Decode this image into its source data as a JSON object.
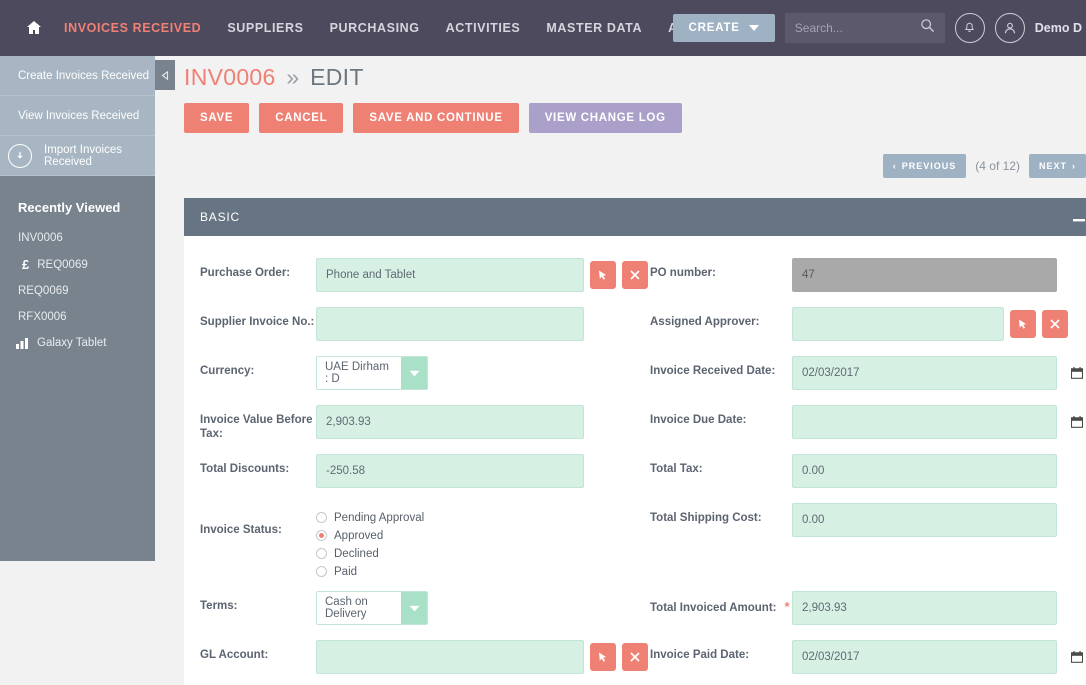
{
  "topnav": {
    "home_icon": "home-icon",
    "links": [
      {
        "label": "INVOICES RECEIVED",
        "active": true
      },
      {
        "label": "SUPPLIERS",
        "active": false
      },
      {
        "label": "PURCHASING",
        "active": false
      },
      {
        "label": "ACTIVITIES",
        "active": false
      },
      {
        "label": "MASTER DATA",
        "active": false
      },
      {
        "label": "ALL",
        "active": false
      }
    ],
    "create_label": "CREATE",
    "search_placeholder": "Search...",
    "search_value": "",
    "username": "Demo D",
    "accent": "#ef8074",
    "bar_color": "#4e4a5e"
  },
  "sidebar": {
    "actions": [
      {
        "label": "Create Invoices Received",
        "icon": ""
      },
      {
        "label": "View Invoices Received",
        "icon": ""
      },
      {
        "label": "Import Invoices Received",
        "icon": "download-circle-icon"
      }
    ],
    "recent_title": "Recently Viewed",
    "recent_items": [
      {
        "label": "INV0006",
        "icon": ""
      },
      {
        "label": "REQ0069",
        "icon": "£"
      },
      {
        "label": "REQ0069",
        "icon": ""
      },
      {
        "label": "RFX0006",
        "icon": ""
      },
      {
        "label": "Galaxy Tablet",
        "icon": "bar-chart-icon"
      }
    ]
  },
  "page": {
    "record_id": "INV0006",
    "separator": "»",
    "mode": "EDIT",
    "buttons": [
      {
        "label": "SAVE",
        "style": "coral"
      },
      {
        "label": "CANCEL",
        "style": "coral"
      },
      {
        "label": "SAVE AND CONTINUE",
        "style": "coral"
      },
      {
        "label": "VIEW CHANGE LOG",
        "style": "purple"
      }
    ],
    "pager": {
      "previous": "PREVIOUS",
      "count": "(4 of 12)",
      "next": "NEXT"
    }
  },
  "panel": {
    "title": "BASIC",
    "collapse_glyph": "—",
    "left_fields": [
      {
        "label": "Purchase Order:",
        "type": "text-picker",
        "value": "Phone and Tablet",
        "required": false
      },
      {
        "label": "Supplier Invoice No.:",
        "type": "text",
        "value": "",
        "required": false
      },
      {
        "label": "Currency:",
        "type": "select",
        "value": "UAE Dirham : D",
        "required": false
      },
      {
        "label": "Invoice Value Before Tax:",
        "type": "text",
        "value": "2,903.93",
        "required": false
      },
      {
        "label": "Total Discounts:",
        "type": "text",
        "value": "-250.58",
        "required": false
      },
      {
        "label": "Invoice Status:",
        "type": "radio",
        "value": "Approved",
        "required": false,
        "options": [
          "Pending Approval",
          "Approved",
          "Declined",
          "Paid"
        ]
      },
      {
        "label": "Terms:",
        "type": "select",
        "value": "Cash on Delivery",
        "required": false
      },
      {
        "label": "GL Account:",
        "type": "text-picker",
        "value": "",
        "required": false
      }
    ],
    "right_fields": [
      {
        "label": "PO number:",
        "type": "text",
        "value": "47",
        "disabled": true,
        "required": false
      },
      {
        "label": "Assigned Approver:",
        "type": "text-picker",
        "value": "",
        "required": false
      },
      {
        "label": "Invoice Received Date:",
        "type": "date",
        "value": "02/03/2017",
        "required": false
      },
      {
        "label": "Invoice Due Date:",
        "type": "date",
        "value": "",
        "required": false
      },
      {
        "label": "Total Tax:",
        "type": "text",
        "value": "0.00",
        "required": false
      },
      {
        "label": "Total Shipping Cost:",
        "type": "text",
        "value": "0.00",
        "required": false
      },
      {
        "label": "Total Invoiced Amount:",
        "type": "text",
        "value": "2,903.93",
        "required": true
      },
      {
        "label": "Invoice Paid Date:",
        "type": "date",
        "value": "02/03/2017",
        "required": false
      }
    ]
  }
}
